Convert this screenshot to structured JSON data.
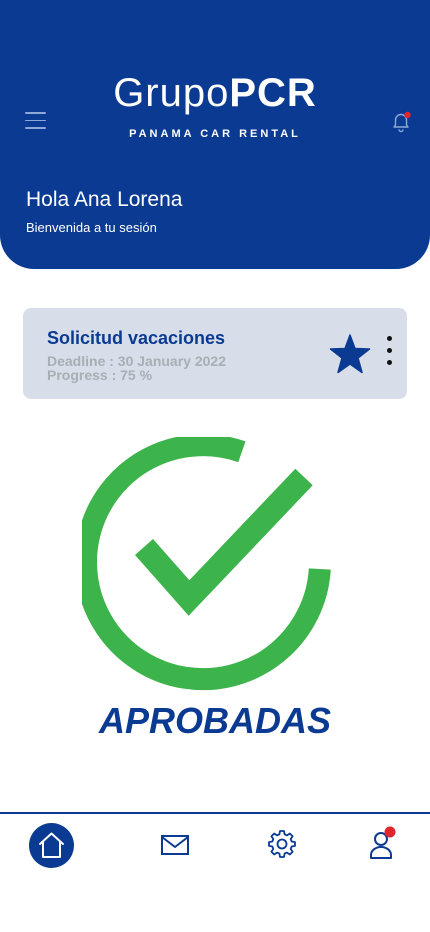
{
  "header": {
    "logo_light": "Grupo",
    "logo_bold": "PCR",
    "logo_sub": "PANAMA CAR RENTAL",
    "greeting": "Hola Ana Lorena",
    "welcome": "Bienvenida a tu sesión"
  },
  "card": {
    "title": "Solicitud vacaciones",
    "deadline": "Deadline : 30 January 2022",
    "progress": "Progress : 75 %"
  },
  "status": {
    "label": "APROBADAS"
  },
  "icons": {
    "menu": "menu-icon",
    "bell": "bell-icon",
    "star": "star-icon",
    "more": "more-vertical-icon",
    "check": "check-circle-icon",
    "home": "home-icon",
    "mail": "mail-icon",
    "settings": "gear-icon",
    "user": "user-icon"
  },
  "colors": {
    "brand": "#0b3a93",
    "card_bg": "#d8dee9",
    "success": "#3cb44b",
    "notification": "#e0262b"
  }
}
